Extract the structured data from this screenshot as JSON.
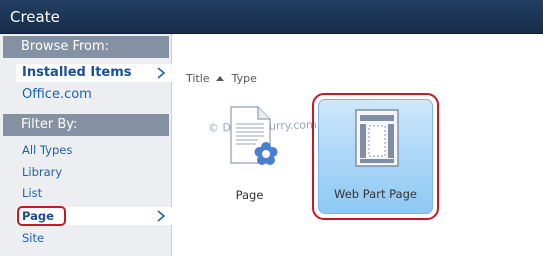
{
  "window": {
    "title": "Create"
  },
  "sidebar": {
    "browse_header": "Browse From:",
    "browse_items": [
      {
        "label": "Installed Items",
        "selected": true
      },
      {
        "label": "Office.com",
        "selected": false
      }
    ],
    "filter_header": "Filter By:",
    "filter_items": [
      {
        "label": "All Types",
        "selected": false
      },
      {
        "label": "Library",
        "selected": false
      },
      {
        "label": "List",
        "selected": false
      },
      {
        "label": "Page",
        "selected": true
      },
      {
        "label": "Site",
        "selected": false
      }
    ]
  },
  "main": {
    "sort": {
      "title_label": "Title",
      "type_label": "Type",
      "title_sort": "ascending"
    },
    "watermark": "© DotNetCurry.com",
    "tiles": [
      {
        "label": "Page",
        "icon": "page-icon",
        "selected": false
      },
      {
        "label": "Web Part Page",
        "icon": "web-part-page-icon",
        "selected": true
      }
    ]
  },
  "colors": {
    "titlebar": "#1c365a",
    "section_header": "#8491a2",
    "link": "#1e60a9",
    "highlight": "#c7182a",
    "tile_selected": "#a8d5f7"
  }
}
